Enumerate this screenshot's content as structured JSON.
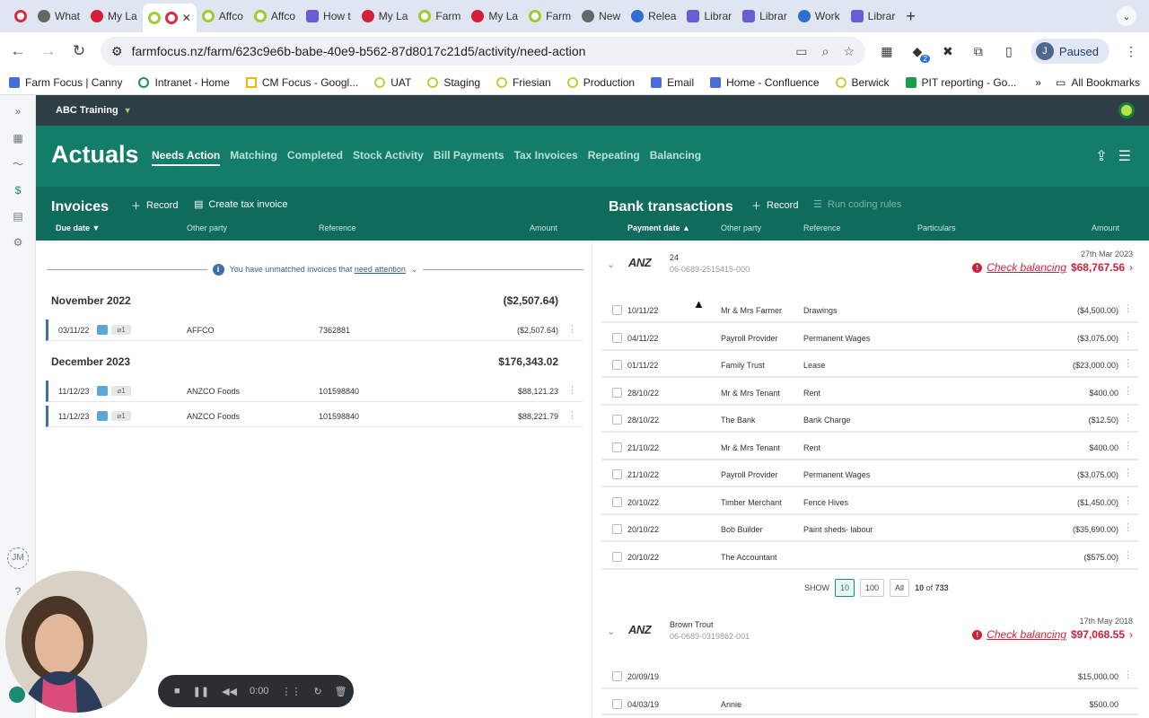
{
  "browser": {
    "tabs": [
      {
        "label": "What",
        "icon": "github-icon",
        "color": "gray"
      },
      {
        "label": "My La",
        "icon": "mylab-icon",
        "color": "red"
      },
      {
        "label": "",
        "icon": "farmfocus-icon",
        "color": "green",
        "active": true
      },
      {
        "label": "Affco",
        "icon": "farmfocus-icon",
        "color": "green"
      },
      {
        "label": "Affco",
        "icon": "farmfocus-icon",
        "color": "green"
      },
      {
        "label": "How t",
        "icon": "settings-icon",
        "color": "purple"
      },
      {
        "label": "My La",
        "icon": "mylab-icon",
        "color": "red"
      },
      {
        "label": "Farm",
        "icon": "farmfocus-icon",
        "color": "green"
      },
      {
        "label": "My La",
        "icon": "mylab-icon",
        "color": "red"
      },
      {
        "label": "Farm",
        "icon": "farmfocus-icon",
        "color": "green"
      },
      {
        "label": "New",
        "icon": "github-icon",
        "color": "gray"
      },
      {
        "label": "Relea",
        "icon": "confluence-icon",
        "color": "blue"
      },
      {
        "label": "Librar",
        "icon": "settings-icon",
        "color": "purple"
      },
      {
        "label": "Librar",
        "icon": "settings-icon",
        "color": "purple"
      },
      {
        "label": "Work",
        "icon": "workspace-icon",
        "color": "blue"
      },
      {
        "label": "Librar",
        "icon": "settings-icon",
        "color": "purple"
      }
    ],
    "url": "farmfocus.nz/farm/623c9e6b-babe-40e9-b562-87d8017c21d5/activity/need-action",
    "profile_initial": "J",
    "profile_status": "Paused",
    "extension_badge": "2",
    "bookmarks": [
      "Farm Focus | Canny",
      "Intranet - Home",
      "CM Focus - Googl...",
      "UAT",
      "Staging",
      "Friesian",
      "Production",
      "Email",
      "Home - Confluence",
      "Berwick",
      "PIT reporting - Go..."
    ],
    "all_bookmarks": "All Bookmarks",
    "new_tab": "+"
  },
  "app": {
    "org_name": "ABC Training",
    "rail_user_initials": "JM",
    "page_title": "Actuals",
    "nav_tabs": [
      "Needs Action",
      "Matching",
      "Completed",
      "Stock Activity",
      "Bill Payments",
      "Tax Invoices",
      "Repeating",
      "Balancing"
    ],
    "invoices": {
      "title": "Invoices",
      "record_label": "Record",
      "create_tax_invoice_label": "Create tax invoice",
      "columns": {
        "due_date": "Due date",
        "other_party": "Other party",
        "reference": "Reference",
        "amount": "Amount"
      },
      "notice_prefix": "You have unmatched invoices that ",
      "notice_link": "need attention",
      "groups": [
        {
          "title": "November 2022",
          "total": "($2,507.64)",
          "rows": [
            {
              "date": "03/11/22",
              "attachments": "1",
              "party": "AFFCO",
              "reference": "7362881",
              "amount": "($2,507.64)"
            }
          ]
        },
        {
          "title": "December 2023",
          "total": "$176,343.02",
          "rows": [
            {
              "date": "11/12/23",
              "attachments": "1",
              "party": "ANZCO Foods",
              "reference": "101598840",
              "amount": "$88,121.23"
            },
            {
              "date": "11/12/23",
              "attachments": "1",
              "party": "ANZCO Foods",
              "reference": "101598840",
              "amount": "$88,221.79"
            }
          ]
        }
      ]
    },
    "bank": {
      "title": "Bank transactions",
      "record_label": "Record",
      "run_coding_rules_label": "Run coding rules",
      "columns": {
        "payment_date": "Payment date",
        "other_party": "Other party",
        "reference": "Reference",
        "particulars": "Particulars",
        "amount": "Amount"
      },
      "accounts": [
        {
          "bank": "ANZ",
          "name": "24",
          "number": "06-0689-2515415-000",
          "date": "27th Mar 2023",
          "check_label": "Check balancing",
          "balance": "$68,767.56",
          "rows": [
            {
              "date": "10/11/22",
              "party": "Mr & Mrs Farmer",
              "reference": "Drawings",
              "amount": "($4,500.00)"
            },
            {
              "date": "04/11/22",
              "party": "Payroll Provider",
              "reference": "Permanent Wages",
              "amount": "($3,075.00)"
            },
            {
              "date": "01/11/22",
              "party": "Family Trust",
              "reference": "Lease",
              "amount": "($23,000.00)"
            },
            {
              "date": "28/10/22",
              "party": "Mr & Mrs Tenant",
              "reference": "Rent",
              "amount": "$400.00"
            },
            {
              "date": "28/10/22",
              "party": "The Bank",
              "reference": "Bank Charge",
              "amount": "($12.50)"
            },
            {
              "date": "21/10/22",
              "party": "Mr & Mrs Tenant",
              "reference": "Rent",
              "amount": "$400.00"
            },
            {
              "date": "21/10/22",
              "party": "Payroll Provider",
              "reference": "Permanent Wages",
              "amount": "($3,075.00)"
            },
            {
              "date": "20/10/22",
              "party": "Timber Merchant",
              "reference": "Fence Hives",
              "amount": "($1,450.00)"
            },
            {
              "date": "20/10/22",
              "party": "Bob Builder",
              "reference": "Paint sheds- labour",
              "amount": "($35,690.00)"
            },
            {
              "date": "20/10/22",
              "party": "The Accountant",
              "reference": "",
              "amount": "($575.00)"
            }
          ],
          "pager": {
            "show_label": "SHOW",
            "options": [
              "10",
              "100",
              "All"
            ],
            "selected": "10",
            "count_current": "10",
            "count_of": "of",
            "count_total": "733"
          }
        },
        {
          "bank": "ANZ",
          "name": "Brown Trout",
          "number": "06-0689-0319862-001",
          "date": "17th May 2018",
          "check_label": "Check balancing",
          "balance": "$97,068.55",
          "rows": [
            {
              "date": "20/09/19",
              "party": "",
              "reference": "",
              "amount": "$15,000.00"
            },
            {
              "date": "04/03/19",
              "party": "Annie",
              "reference": "",
              "amount": "$500.00"
            }
          ]
        }
      ]
    }
  },
  "recorder": {
    "time": "0:00"
  },
  "colors": {
    "teal_header": "#137d6a",
    "teal_subheader": "#0f6b5b",
    "dark_strip": "#2d3e44",
    "alert_red": "#d0213b",
    "accent_blue": "#3f6fa8"
  }
}
